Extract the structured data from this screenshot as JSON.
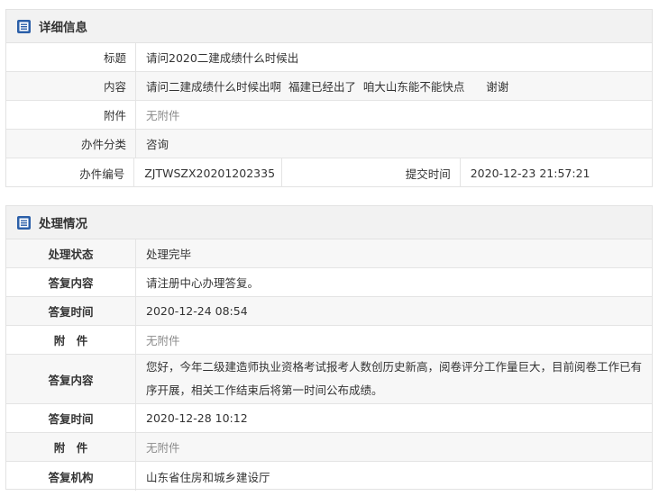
{
  "detail": {
    "title": "详细信息",
    "rows": [
      {
        "label": "标题",
        "value": "请问2020二建成绩什么时候出"
      },
      {
        "label": "内容",
        "value": "请问二建成绩什么时候出啊  福建已经出了  咱大山东能不能快点      谢谢"
      },
      {
        "label": "附件",
        "value": "无附件"
      },
      {
        "label": "办件分类",
        "value": "咨询"
      }
    ],
    "case_no_label": "办件编号",
    "case_no": "ZJTWSZX20201202335",
    "submit_label": "提交时间",
    "submit_time": "2020-12-23 21:57:21"
  },
  "process": {
    "title": "处理情况",
    "rows": [
      {
        "label": "处理状态",
        "value": "处理完毕"
      },
      {
        "label": "答复内容",
        "value": "请注册中心办理答复。"
      },
      {
        "label": "答复时间",
        "value": "2020-12-24 08:54"
      },
      {
        "label": "附　件",
        "value": "无附件"
      },
      {
        "label": "答复内容",
        "value": "您好，今年二级建造师执业资格考试报考人数创历史新高，阅卷评分工作量巨大，目前阅卷工作已有序开展，相关工作结束后将第一时间公布成绩。"
      },
      {
        "label": "答复时间",
        "value": "2020-12-28 10:12"
      },
      {
        "label": "附　件",
        "value": "无附件"
      },
      {
        "label": "答复机构",
        "value": "山东省住房和城乡建设厅"
      }
    ]
  },
  "icons": {
    "header": "document-list-icon",
    "color": "#2b5fa8"
  }
}
